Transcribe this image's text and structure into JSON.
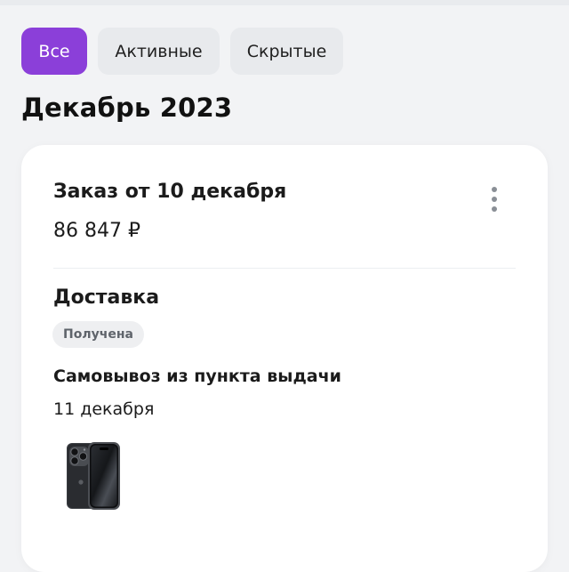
{
  "filters": {
    "all_label": "Все",
    "active_label": "Активные",
    "hidden_label": "Скрытые"
  },
  "month_title": "Декабрь 2023",
  "order": {
    "title": "Заказ от 10 декабря",
    "total": "86 847 ₽",
    "more_icon": "more-vertical-icon",
    "delivery": {
      "title": "Доставка",
      "status": "Получена",
      "method": "Самовывоз из пункта выдачи",
      "date": "11 декабря"
    },
    "items": [
      {
        "image": "phone-product-image"
      }
    ]
  },
  "colors": {
    "accent": "#8b3fd9",
    "background": "#f2f3f5",
    "card": "#ffffff",
    "chip_inactive": "#e8eaed",
    "badge_bg": "#eeeff1",
    "badge_text": "#5f646b"
  }
}
